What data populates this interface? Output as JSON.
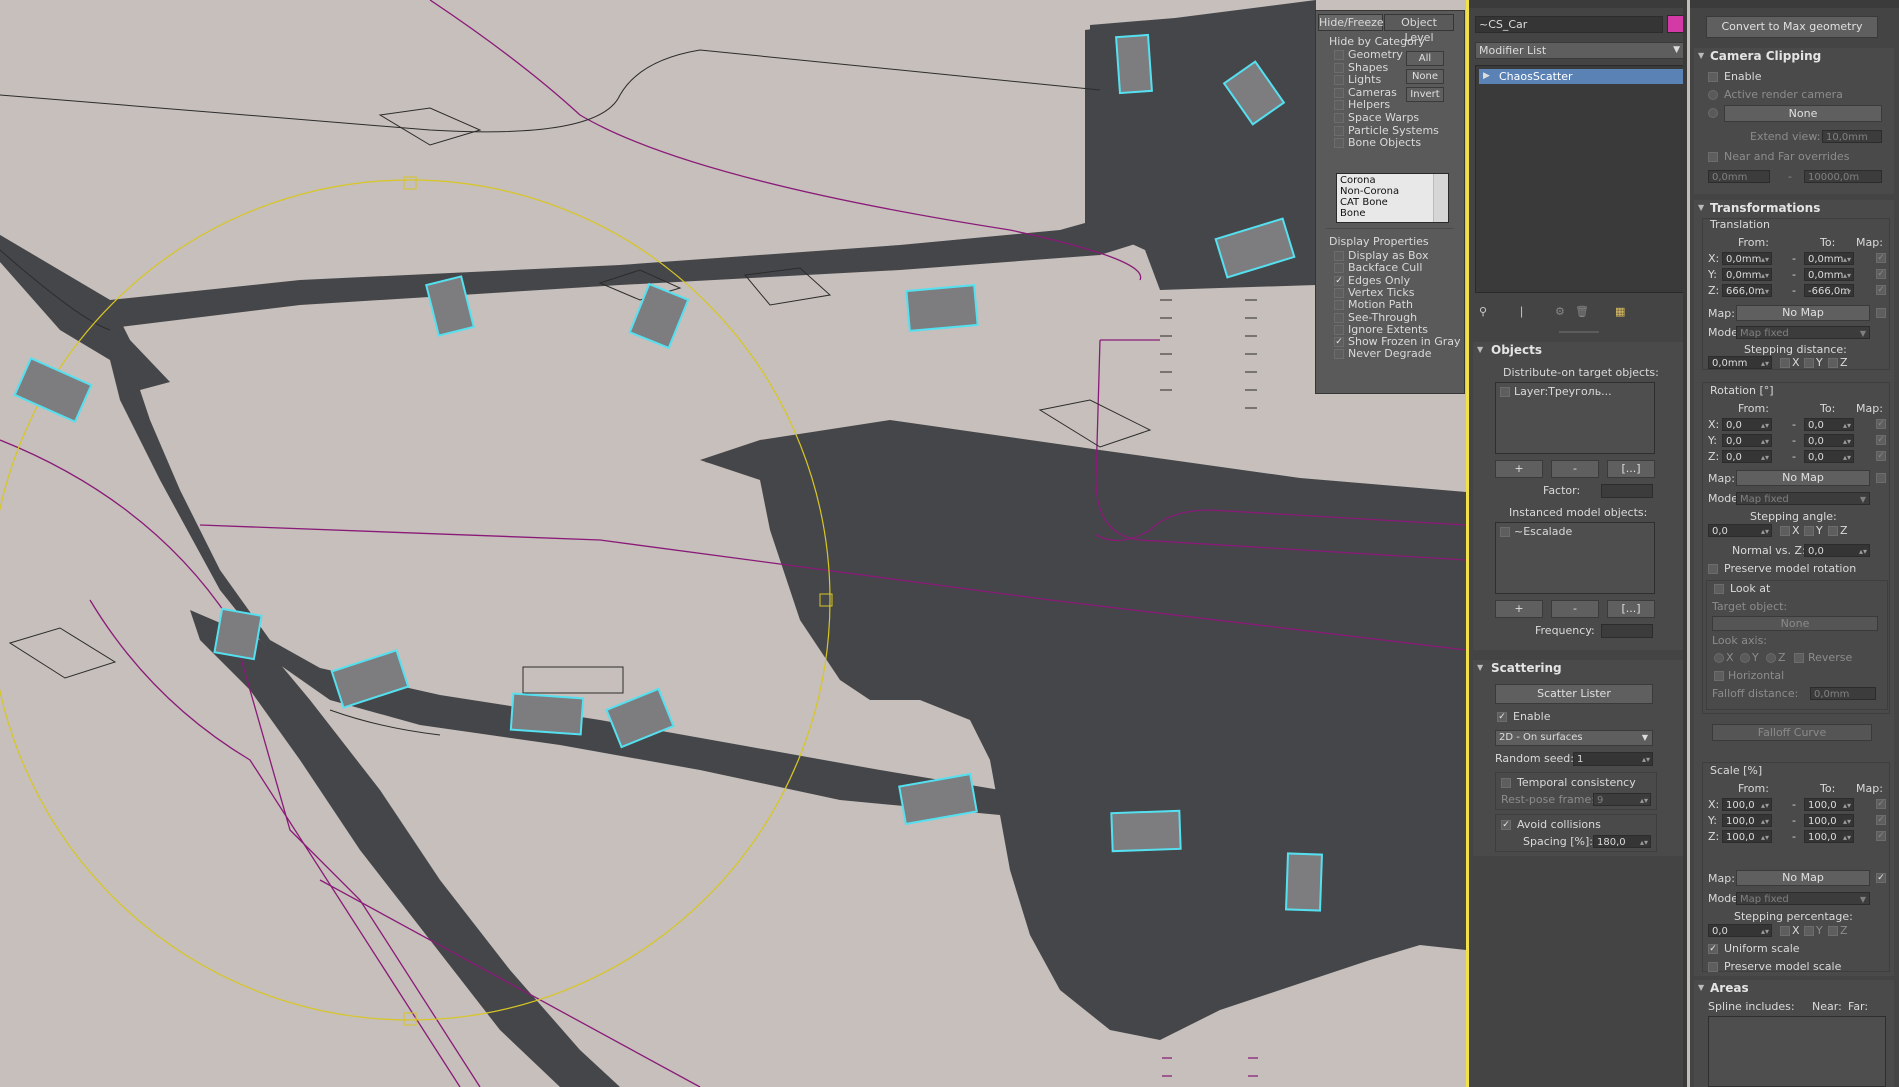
{
  "viewport": {
    "selection_color": "#55e0f0",
    "gizmo_color": "#d8c623",
    "road_color": "#444549",
    "spline_color": "#8a1a78",
    "ground_color": "#c6bfbb"
  },
  "hide_freeze": {
    "tabs": [
      "Hide/Freeze",
      "Object Level"
    ],
    "hide_by_category_title": "Hide by Category",
    "categories": [
      {
        "label": "Geometry",
        "checked": false
      },
      {
        "label": "Shapes",
        "checked": false
      },
      {
        "label": "Lights",
        "checked": false
      },
      {
        "label": "Cameras",
        "checked": false
      },
      {
        "label": "Helpers",
        "checked": false
      },
      {
        "label": "Space Warps",
        "checked": false
      },
      {
        "label": "Particle Systems",
        "checked": false
      },
      {
        "label": "Bone Objects",
        "checked": false
      }
    ],
    "buttons": [
      "All",
      "None",
      "Invert"
    ],
    "list_items": [
      "Corona",
      "Non-Corona",
      "CAT Bone",
      "Bone"
    ],
    "display_properties_title": "Display Properties",
    "display_properties": [
      {
        "label": "Display as Box",
        "checked": false
      },
      {
        "label": "Backface Cull",
        "checked": false
      },
      {
        "label": "Edges Only",
        "checked": true
      },
      {
        "label": "Vertex Ticks",
        "checked": false
      },
      {
        "label": "Motion Path",
        "checked": false
      },
      {
        "label": "See-Through",
        "checked": false
      },
      {
        "label": "Ignore Extents",
        "checked": false
      },
      {
        "label": "Show Frozen in Gray",
        "checked": true
      },
      {
        "label": "Never Degrade",
        "checked": false
      }
    ]
  },
  "modify": {
    "object_name": "~CS_Car",
    "object_color": "#d43aa6",
    "modifier_list_label": "Modifier List",
    "stack_items": [
      "ChaosScatter"
    ]
  },
  "objects": {
    "title": "Objects",
    "distribute_label": "Distribute-on target objects:",
    "distribute_items": [
      "Layer:Треуголь..."
    ],
    "add_label": "+",
    "remove_label": "-",
    "more_label": "[...]",
    "factor_label": "Factor:",
    "instanced_label": "Instanced model objects:",
    "instanced_items": [
      "~Escalade"
    ],
    "frequency_label": "Frequency:"
  },
  "scattering": {
    "title": "Scattering",
    "lister_button": "Scatter Lister",
    "enable_label": "Enable",
    "enable_checked": true,
    "mode_value": "2D - On surfaces",
    "seed_label": "Random seed:",
    "seed_value": "1",
    "temporal_label": "Temporal consistency",
    "temporal_checked": false,
    "rest_pose_label": "Rest-pose frame:",
    "rest_pose_value": "9",
    "avoid_label": "Avoid collisions",
    "avoid_checked": true,
    "spacing_label": "Spacing [%]:",
    "spacing_value": "180,0"
  },
  "right": {
    "convert_button": "Convert to Max geometry",
    "camera_clipping": {
      "title": "Camera Clipping",
      "enable_label": "Enable",
      "active_camera_label": "Active render camera",
      "camera_none": "None",
      "extend_label": "Extend view:",
      "extend_value": "10,0mm",
      "near_far_label": "Near and Far overrides",
      "near_value": "0,0mm",
      "far_value": "10000,0m"
    },
    "transformations": {
      "title": "Transformations",
      "translation_label": "Translation",
      "from_label": "From:",
      "to_label": "To:",
      "map_label": "Map:",
      "translation_rows": [
        {
          "axis": "X:",
          "from": "0,0mm",
          "to": "0,0mm"
        },
        {
          "axis": "Y:",
          "from": "0,0mm",
          "to": "0,0mm"
        },
        {
          "axis": "Z:",
          "from": "666,0m",
          "to": "-666,0m"
        }
      ],
      "no_map": "No Map",
      "mode_label": "Mode:",
      "map_fixed": "Map fixed",
      "stepping_distance_label": "Stepping distance:",
      "stepping_distance_value": "0,0mm",
      "x_label": "X",
      "y_label": "Y",
      "z_label": "Z",
      "rotation_label": "Rotation [°]",
      "rotation_rows": [
        {
          "axis": "X:",
          "from": "0,0",
          "to": "0,0"
        },
        {
          "axis": "Y:",
          "from": "0,0",
          "to": "0,0"
        },
        {
          "axis": "Z:",
          "from": "0,0",
          "to": "0,0"
        }
      ],
      "stepping_angle_label": "Stepping angle:",
      "stepping_angle_value": "0,0",
      "normal_label": "Normal vs. Z:",
      "normal_value": "0,0",
      "preserve_rotation_label": "Preserve model rotation",
      "look_at_label": "Look at",
      "target_object_label": "Target object:",
      "target_none": "None",
      "look_axis_label": "Look axis:",
      "reverse_label": "Reverse",
      "horizontal_label": "Horizontal",
      "falloff_distance_label": "Falloff distance:",
      "falloff_distance_value": "0,0mm",
      "falloff_curve_button": "Falloff Curve",
      "scale_label": "Scale [%]",
      "scale_rows": [
        {
          "axis": "X:",
          "from": "100,0",
          "to": "100,0"
        },
        {
          "axis": "Y:",
          "from": "100,0",
          "to": "100,0"
        },
        {
          "axis": "Z:",
          "from": "100,0",
          "to": "100,0"
        }
      ],
      "stepping_percentage_label": "Stepping percentage:",
      "stepping_percentage_value": "0,0",
      "uniform_scale_label": "Uniform scale",
      "preserve_scale_label": "Preserve model scale"
    },
    "areas": {
      "title": "Areas",
      "spline_includes_label": "Spline includes:",
      "near_label": "Near:",
      "far_label": "Far:"
    }
  }
}
